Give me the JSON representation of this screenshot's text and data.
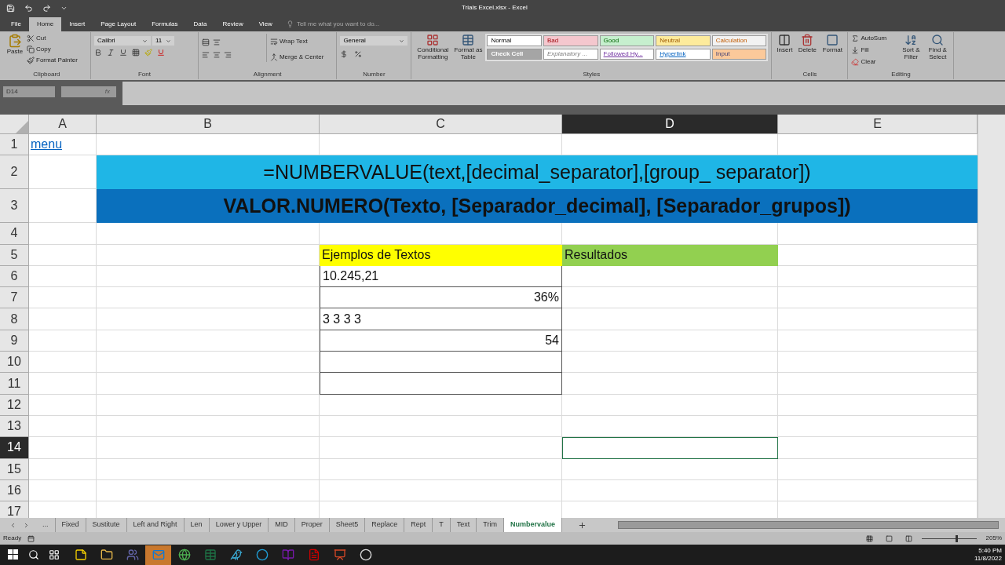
{
  "window": {
    "title": "Trials Excel.xlsx - Excel"
  },
  "ribbon": {
    "tabs": [
      {
        "label": "File",
        "selected": false
      },
      {
        "label": "Home",
        "selected": true
      },
      {
        "label": "Insert",
        "selected": false
      },
      {
        "label": "Page Layout",
        "selected": false
      },
      {
        "label": "Formulas",
        "selected": false
      },
      {
        "label": "Data",
        "selected": false
      },
      {
        "label": "Review",
        "selected": false
      },
      {
        "label": "View",
        "selected": false
      }
    ],
    "tell_me": {
      "placeholder": "Tell me what you want to do..."
    },
    "clipboard": {
      "label": "Clipboard",
      "buttons": [
        "Paste",
        "Cut",
        "Copy",
        "Format Painter"
      ]
    },
    "font": {
      "label": "Font",
      "font": "Calibri",
      "size": "11"
    },
    "alignment": {
      "label": "Alignment",
      "buttons": [
        "Wrap Text",
        "Merge & Center"
      ]
    },
    "number": {
      "label": "Number",
      "format": "General"
    },
    "styles": {
      "label": "Styles",
      "buttons": [
        "Conditional Formatting",
        "Format as Table"
      ],
      "gallery": [
        {
          "label": "Normal",
          "kind": "normal",
          "color": "#ffffff"
        },
        {
          "label": "Bad",
          "kind": "bad",
          "color": "#f4c7ce"
        },
        {
          "label": "Good",
          "kind": "good",
          "color": "#c6efce"
        },
        {
          "label": "Neutral",
          "kind": "neutral",
          "color": "#fdeb9c"
        },
        {
          "label": "Calculation",
          "kind": "calculation",
          "color": "#f2f2f2"
        },
        {
          "label": "Check Cell",
          "kind": "check",
          "color": "#a5a5a5"
        },
        {
          "label": "Explanatory ...",
          "kind": "explanatory",
          "color": "#ffffff"
        },
        {
          "label": "Followed Hy...",
          "kind": "followed",
          "color": "#ffffff"
        },
        {
          "label": "Hyperlink",
          "kind": "hyperlink",
          "color": "#ffffff"
        },
        {
          "label": "Input",
          "kind": "input",
          "color": "#fbc99a"
        }
      ]
    },
    "cells": {
      "label": "Cells",
      "buttons": [
        "Insert",
        "Delete",
        "Format"
      ]
    },
    "editing": {
      "label": "Editing",
      "buttons": [
        "AutoSum",
        "Fill",
        "Clear",
        "Sort & Filter",
        "Find & Select"
      ]
    }
  },
  "name_box": "D14",
  "function_label": "fx",
  "sheet": {
    "columns": [
      {
        "label": "A",
        "selected": false
      },
      {
        "label": "B",
        "selected": false
      },
      {
        "label": "C",
        "selected": false
      },
      {
        "label": "D",
        "selected": true
      },
      {
        "label": "E",
        "selected": false
      }
    ],
    "rows": [
      {
        "label": "1",
        "selected": false,
        "cells": [
          {
            "text": "menu",
            "kind": "link"
          }
        ]
      },
      {
        "label": "2",
        "selected": false,
        "cells": [
          {
            "kind": "blank"
          },
          {
            "text": "=NUMBERVALUE(text,[decimal_separator],[group_ separator])",
            "kind": "heading",
            "color": "#1fb6e6",
            "colspan": 4
          }
        ]
      },
      {
        "label": "3",
        "selected": false,
        "cells": [
          {
            "kind": "blank"
          },
          {
            "text": "VALOR.NUMERO(Texto, [Separador_decimal], [Separador_grupos])",
            "kind": "heading-bold",
            "color": "#0a70bd",
            "colspan": 4
          }
        ]
      },
      {
        "label": "4",
        "selected": false,
        "cells": []
      },
      {
        "label": "5",
        "selected": false,
        "cells": [
          {
            "kind": "blank"
          },
          {
            "kind": "blank"
          },
          {
            "text": "Ejemplos de Textos",
            "kind": "fill",
            "color": "#ffff00"
          },
          {
            "text": "Resultados",
            "kind": "fill",
            "color": "#92d050"
          }
        ]
      },
      {
        "label": "6",
        "selected": false,
        "cells": [
          {
            "kind": "blank"
          },
          {
            "kind": "blank"
          },
          {
            "text": "10.245,21",
            "kind": "boxed"
          }
        ]
      },
      {
        "label": "7",
        "selected": false,
        "cells": [
          {
            "kind": "blank"
          },
          {
            "kind": "blank"
          },
          {
            "text": "36%",
            "kind": "boxed-right"
          }
        ]
      },
      {
        "label": "8",
        "selected": false,
        "cells": [
          {
            "kind": "blank"
          },
          {
            "kind": "blank"
          },
          {
            "text": "3 3 3 3",
            "kind": "boxed"
          }
        ]
      },
      {
        "label": "9",
        "selected": false,
        "cells": [
          {
            "kind": "blank"
          },
          {
            "kind": "blank"
          },
          {
            "text": "54",
            "kind": "boxed-right"
          }
        ]
      },
      {
        "label": "10",
        "selected": false,
        "cells": [
          {
            "kind": "blank"
          },
          {
            "kind": "blank"
          },
          {
            "kind": "boxed"
          }
        ]
      },
      {
        "label": "11",
        "selected": false,
        "cells": [
          {
            "kind": "blank"
          },
          {
            "kind": "blank"
          },
          {
            "kind": "boxed"
          }
        ]
      },
      {
        "label": "12",
        "selected": false,
        "cells": []
      },
      {
        "label": "13",
        "selected": false,
        "cells": []
      },
      {
        "label": "14",
        "selected": true,
        "cells": [
          {
            "kind": "blank"
          },
          {
            "kind": "blank"
          },
          {
            "kind": "blank"
          },
          {
            "kind": "active"
          }
        ]
      },
      {
        "label": "15",
        "selected": false,
        "cells": []
      },
      {
        "label": "16",
        "selected": false,
        "cells": []
      },
      {
        "label": "17",
        "selected": false,
        "cells": []
      }
    ]
  },
  "sheet_tabs": [
    {
      "label": "...",
      "selected": false
    },
    {
      "label": "Fixed",
      "selected": false
    },
    {
      "label": "Sustitute",
      "selected": false
    },
    {
      "label": "Left and Right",
      "selected": false
    },
    {
      "label": "Len",
      "selected": false
    },
    {
      "label": "Lower y Upper",
      "selected": false
    },
    {
      "label": "MID",
      "selected": false
    },
    {
      "label": "Proper",
      "selected": false
    },
    {
      "label": "Sheet5",
      "selected": false
    },
    {
      "label": "Replace",
      "selected": false
    },
    {
      "label": "Rept",
      "selected": false
    },
    {
      "label": "T",
      "selected": false
    },
    {
      "label": "Text",
      "selected": false
    },
    {
      "label": "Trim",
      "selected": false
    },
    {
      "label": "Numbervalue",
      "selected": true
    }
  ],
  "status_bar": {
    "status": "Ready",
    "zoom": "205%",
    "zoom_level": {
      "level": 0.62
    }
  },
  "taskbar": {
    "apps": [
      {
        "kind": "notes",
        "selected": false
      },
      {
        "kind": "folder",
        "selected": false
      },
      {
        "kind": "teams",
        "selected": false
      },
      {
        "kind": "outlook",
        "selected": true
      },
      {
        "kind": "chrome",
        "selected": false
      },
      {
        "kind": "excel",
        "selected": false
      },
      {
        "kind": "bird",
        "selected": false
      },
      {
        "kind": "edge",
        "selected": false
      },
      {
        "kind": "onenote",
        "selected": false
      },
      {
        "kind": "pdf",
        "selected": false
      },
      {
        "kind": "powerpoint",
        "selected": false
      },
      {
        "kind": "obs",
        "selected": false
      }
    ],
    "time": "5:40 PM",
    "date": "11/8/2022"
  }
}
